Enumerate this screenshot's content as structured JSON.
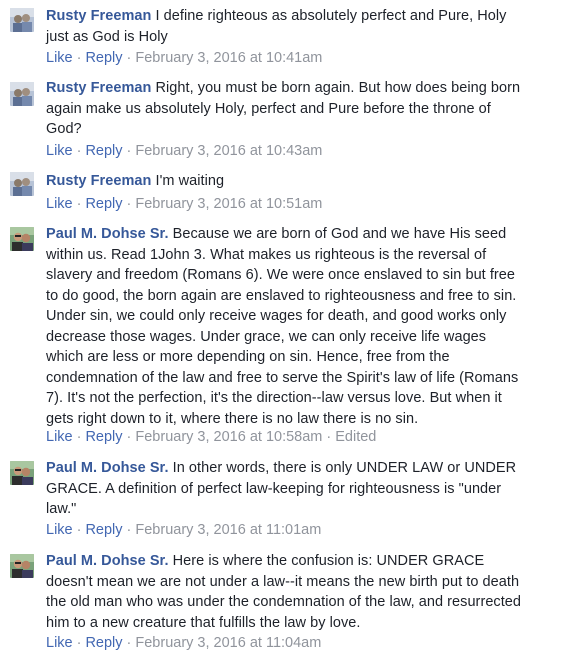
{
  "comments": [
    {
      "author": "Rusty Freeman",
      "text": "I define righteous as absolutely perfect and Pure, Holy just as God is Holy",
      "like": "Like",
      "reply": "Reply",
      "time": "February 3, 2016 at 10:41am",
      "edited": ""
    },
    {
      "author": "Rusty Freeman",
      "text": "Right, you must be born again. But how does being born again make us absolutely Holy, perfect and Pure before the throne of God?",
      "like": "Like",
      "reply": "Reply",
      "time": "February 3, 2016 at 10:43am",
      "edited": ""
    },
    {
      "author": "Rusty Freeman",
      "text": "I'm waiting",
      "like": "Like",
      "reply": "Reply",
      "time": "February 3, 2016 at 10:51am",
      "edited": ""
    },
    {
      "author": "Paul M. Dohse Sr.",
      "text": "Because we are born of God and we have His seed within us. Read 1John 3. What makes us righteous is the reversal of slavery and freedom (Romans 6). We were once enslaved to sin but free to do good, the born again are enslaved to righteousness and free to sin. Under sin, we could only receive wages for death, and good works only decrease those wages. Under grace, we can only receive life wages which are less or more depending on sin. Hence, free from the condemnation of the law and free to serve the Spirit's law of life (Romans 7). It's not the perfection, it's the direction--law versus love. But when it gets right down to it, where there is no law there is no sin.",
      "like": "Like",
      "reply": "Reply",
      "time": "February 3, 2016 at 10:58am",
      "edited": "Edited"
    },
    {
      "author": "Paul M. Dohse Sr.",
      "text": "In other words, there is only UNDER LAW or UNDER GRACE. A definition of perfect law-keeping for righteousness is \"under law.\"",
      "like": "Like",
      "reply": "Reply",
      "time": "February 3, 2016 at 11:01am",
      "edited": ""
    },
    {
      "author": "Paul M. Dohse Sr.",
      "text": "Here is where the confusion is: UNDER GRACE doesn't mean we are not under a law--it means the new birth put to death the old man who was under the condemnation of the law, and resurrected him to a new creature that fulfills the law by love.",
      "like": "Like",
      "reply": "Reply",
      "time": "February 3, 2016 at 11:04am",
      "edited": ""
    }
  ],
  "meta_separator": "·",
  "avatar_icons": [
    "rusty-freeman-avatar-icon",
    "paul-dohse-avatar-icon"
  ],
  "colors": {
    "link": "#365899",
    "action": "#4267b2",
    "meta": "#90949c",
    "text": "#1d2129"
  }
}
